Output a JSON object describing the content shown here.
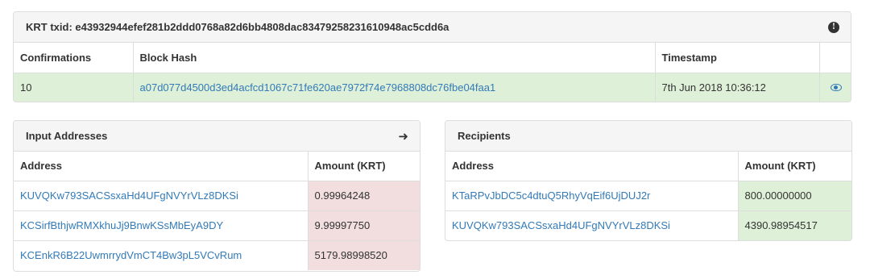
{
  "tx": {
    "heading": "KRT txid: e43932944efef281b2ddd0768a82d6bb4808dac8347925823161​0948ac5cdd6a",
    "columns": [
      "Confirmations",
      "Block Hash",
      "Timestamp"
    ],
    "confirmations": "10",
    "block_hash": "a07d077d4500d3ed4acfcd1067c71fe620ae7972f74e7968808dc76fbe04faa1",
    "timestamp": "7th Jun 2018 10:36:12",
    "info_icon": "info-icon",
    "view_icon": "eye-icon"
  },
  "inputs": {
    "heading": "Input Addresses",
    "arrow_icon": "arrow-right-icon",
    "columns": [
      "Address",
      "Amount (KRT)"
    ],
    "rows": [
      {
        "address": "KUVQKw793SACSsxaHd4UFgNVYrVLz8DKSi",
        "amount": "0.99964248"
      },
      {
        "address": "KCSirfBthjwRMXkhuJj9BnwKSsMbEyA9DY",
        "amount": "9.99997750"
      },
      {
        "address": "KCEnkR6B22UwmrrydVmCT4Bw3pL5VCvRum",
        "amount": "5179.98998520"
      }
    ]
  },
  "recipients": {
    "heading": "Recipients",
    "columns": [
      "Address",
      "Amount (KRT)"
    ],
    "rows": [
      {
        "address": "KTaRPvJbDC5c4dtuQ5RhyVqEif6UjDUJ2r",
        "amount": "800.00000000"
      },
      {
        "address": "KUVQKw793SACSsxaHd4UFgNVYrVLz8DKSi",
        "amount": "4390.98954517"
      }
    ]
  },
  "colors": {
    "link": "#337ab7",
    "success_bg": "#dff0d8",
    "danger_bg": "#f2dede"
  }
}
